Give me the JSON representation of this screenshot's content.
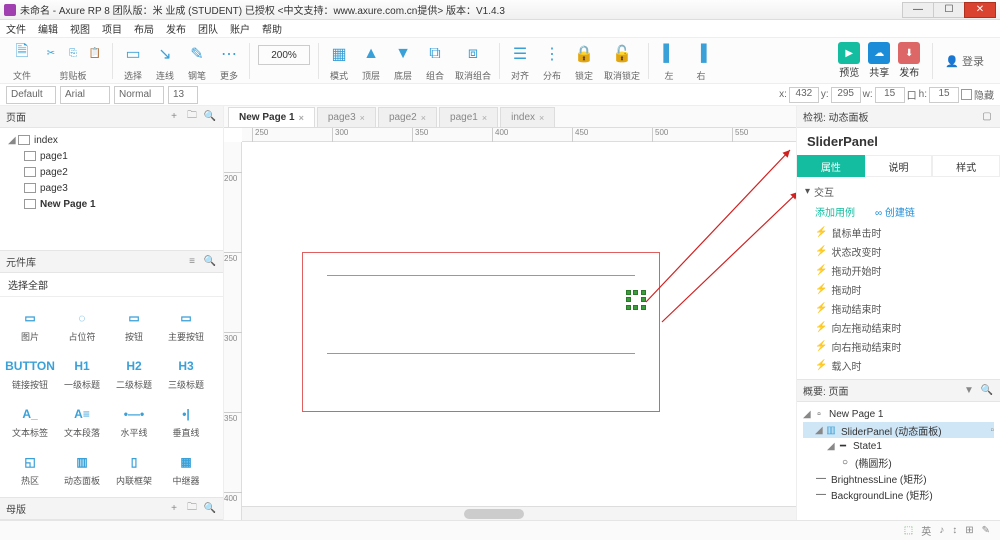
{
  "title": "未命名 - Axure RP 8 团队版：米 业成 (STUDENT) 已授权 <中文支持：www.axure.com.cn提供> 版本：V1.4.3",
  "menu": [
    "文件",
    "编辑",
    "视图",
    "项目",
    "布局",
    "发布",
    "团队",
    "账户",
    "帮助"
  ],
  "toolbar": {
    "file": "文件",
    "clipboard": "剪贴板",
    "select": "选择",
    "connect": "连线",
    "pen": "钢笔",
    "more": "更多",
    "zoom_val": "200%",
    "copy": "模式",
    "top": "顶层",
    "bottom": "底层",
    "group": "组合",
    "ungroup": "取消组合",
    "align": "对齐",
    "distribute": "分布",
    "lock": "锁定",
    "unlock": "取消锁定",
    "left": "左",
    "right": "右",
    "preview": "预览",
    "share": "共享",
    "publish": "发布",
    "login": "登录"
  },
  "fmt": {
    "style": "Default",
    "font": "Arial",
    "weight": "Normal",
    "size": "13",
    "x_label": "x:",
    "x": "432",
    "y_label": "y:",
    "y": "295",
    "w_label": "w:",
    "w": "15",
    "h_pre": "口",
    "h_label": "h:",
    "h": "15",
    "hide": "隐藏"
  },
  "pages_panel": {
    "title": "页面"
  },
  "pages": {
    "root": "index",
    "items": [
      "page1",
      "page2",
      "page3",
      "New Page 1"
    ]
  },
  "widlib": {
    "title": "元件库",
    "select_all": "选择全部",
    "rows": [
      [
        {
          "i": "▭",
          "l": "图片"
        },
        {
          "i": "◌",
          "l": "占位符"
        },
        {
          "i": "▭",
          "l": "按钮"
        },
        {
          "i": "▭",
          "l": "主要按钮"
        }
      ],
      [
        {
          "i": "BUTTON",
          "l": "链接按钮"
        },
        {
          "i": "H1",
          "l": "一级标题"
        },
        {
          "i": "H2",
          "l": "二级标题"
        },
        {
          "i": "H3",
          "l": "三级标题"
        }
      ],
      [
        {
          "i": "A_",
          "l": "文本标签"
        },
        {
          "i": "A≡",
          "l": "文本段落"
        },
        {
          "i": "•—•",
          "l": "水平线"
        },
        {
          "i": "•|",
          "l": "垂直线"
        }
      ],
      [
        {
          "i": "◱",
          "l": "热区"
        },
        {
          "i": "▥",
          "l": "动态面板"
        },
        {
          "i": "▯",
          "l": "内联框架"
        },
        {
          "i": "▦",
          "l": "中继器"
        }
      ]
    ]
  },
  "masters": {
    "title": "母版"
  },
  "tabs": [
    "New Page 1",
    "page3",
    "page2",
    "page1",
    "index"
  ],
  "ruler_h": [
    "250",
    "300",
    "350",
    "400",
    "450",
    "500",
    "550"
  ],
  "ruler_v": [
    "200",
    "250",
    "300",
    "350",
    "400"
  ],
  "inspector": {
    "panel_title": "检视: 动态面板",
    "name": "SliderPanel",
    "tabs": [
      "属性",
      "说明",
      "样式"
    ],
    "section": "交互",
    "add_case": "添加用例",
    "create_link": "创建链",
    "events": [
      "鼠标单击时",
      "状态改变时",
      "拖动开始时",
      "拖动时",
      "拖动结束时",
      "向左拖动结束时",
      "向右拖动结束时",
      "载入时"
    ]
  },
  "outline": {
    "title": "概要: 页面",
    "page": "New Page 1",
    "panel": "SliderPanel (动态面板)",
    "state": "State1",
    "ellipse": "(椭圆形)",
    "items": [
      "BrightnessLine (矩形)",
      "BackgroundLine (矩形)"
    ]
  },
  "status": {
    "ime": "英"
  }
}
